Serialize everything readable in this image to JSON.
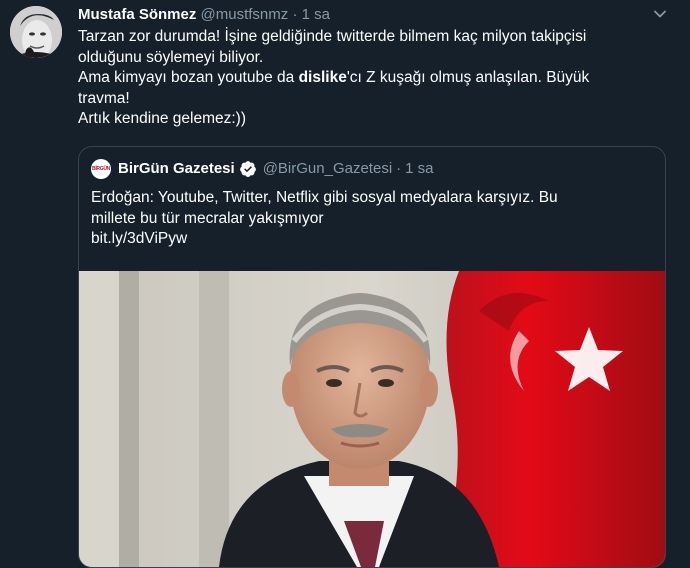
{
  "tweet": {
    "author_name": "Mustafa Sönmez",
    "author_handle": "@mustfsnmz",
    "separator": "·",
    "time": "1 sa",
    "text_lines": [
      "Tarzan zor durumda! İşine geldiğinde twitterde bilmem kaç milyon takipçisi",
      "olduğunu söylemeyi biliyor.",
      "Ama kimyayı bozan youtube da ",
      "dislike",
      "'cı Z kuşağı olmuş anlaşılan. Büyük",
      "travma!",
      "Artık kendine gelemez:))"
    ],
    "menu_icon": "chevron-down-icon"
  },
  "quoted": {
    "author_name": "BirGün Gazetesi",
    "author_handle": "@BirGun_Gazetesi",
    "separator": "·",
    "time": "1 sa",
    "logo_text": "BİRGÜN",
    "verified_icon": "verified-badge-icon",
    "text_lines": [
      "Erdoğan: Youtube, Twitter, Netflix gibi sosyal medyalara karşıyız. Bu",
      "millete bu tür mecralar yakışmıyor",
      "bit.ly/3dViPyw"
    ]
  },
  "colors": {
    "background": "#15202b",
    "text": "#ffffff",
    "muted": "#8899a6",
    "border": "#38444d",
    "verified": "#ffffff",
    "flag_red": "#e30a17"
  }
}
